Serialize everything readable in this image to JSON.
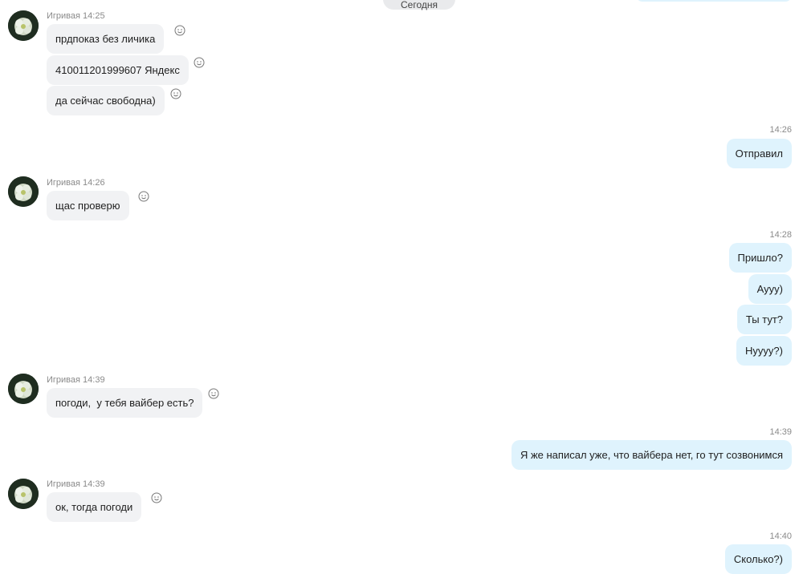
{
  "date_divider": "Сегодня",
  "messages": [
    {
      "sender": "Игривая",
      "time": "14:25",
      "texts": [
        "прдпоказ без личика",
        "410011201999607 Яндекс",
        "да сейчас свободна)"
      ]
    },
    {
      "time": "14:26",
      "texts": [
        "Отправил"
      ]
    },
    {
      "sender": "Игривая",
      "time": "14:26",
      "texts": [
        "щас проверю"
      ]
    },
    {
      "time": "14:28",
      "texts": [
        "Пришло?",
        "Аууу)",
        "Ты тут?",
        "Нуууу?)"
      ]
    },
    {
      "sender": "Игривая",
      "time": "14:39",
      "texts": [
        "погоди,  у тебя вайбер есть?"
      ]
    },
    {
      "time": "14:39",
      "texts": [
        "Я же написал уже, что вайбера нет, го тут созвонимся"
      ]
    },
    {
      "sender": "Игривая",
      "time": "14:39",
      "texts": [
        "ок, тогда погоди"
      ]
    },
    {
      "time": "14:40",
      "texts": [
        "Сколько?)"
      ]
    }
  ],
  "icons": {
    "reaction": "smiley-icon",
    "avatar": "flower-avatar"
  },
  "colors": {
    "incoming_bubble": "#f1f2f4",
    "outgoing_bubble": "#dff3fd",
    "meta_text": "#8a8a8a"
  }
}
